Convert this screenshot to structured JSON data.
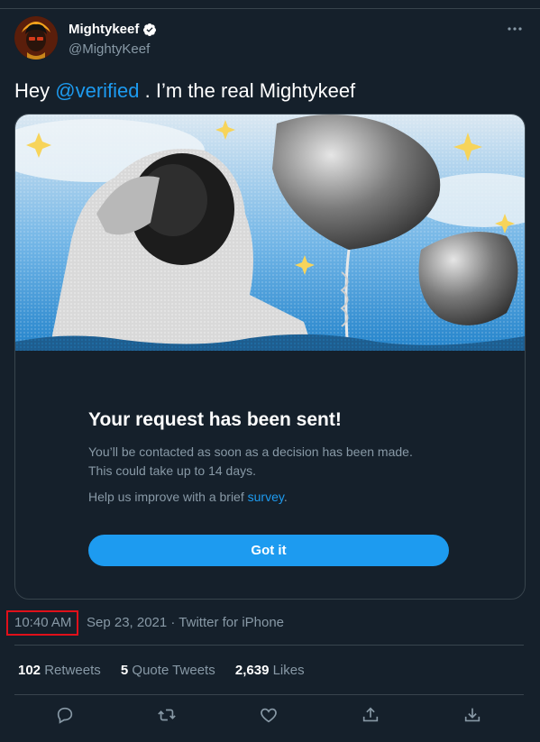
{
  "tweet": {
    "display_name": "Mightykeef",
    "handle": "@MightyKeef",
    "verified_icon": "verified-badge-icon",
    "text_prefix": "Hey ",
    "mention": "@verified",
    "text_suffix": " . I’m the real Mightykeef"
  },
  "card": {
    "title": "Your request has been sent!",
    "body_line1": "You’ll be contacted as soon as a decision has been made.",
    "body_line2": "This could take up to 14 days.",
    "help_prefix": "Help us improve with a brief ",
    "help_link": "survey",
    "help_suffix": ".",
    "button_label": "Got it"
  },
  "meta": {
    "time": "10:40 AM",
    "date_source": "Sep 23, 2021 · Twitter for iPhone"
  },
  "stats": {
    "retweets_count": "102",
    "retweets_label": "Retweets",
    "quotes_count": "5",
    "quotes_label": "Quote Tweets",
    "likes_count": "2,639",
    "likes_label": "Likes"
  },
  "actions": [
    "reply-icon",
    "retweet-icon",
    "like-icon",
    "share-icon",
    "download-icon"
  ],
  "colors": {
    "background": "#15202b",
    "accent": "#1d9bf0",
    "muted_text": "#8899a6",
    "border": "#38444d",
    "highlight_box": "#e0101a"
  }
}
